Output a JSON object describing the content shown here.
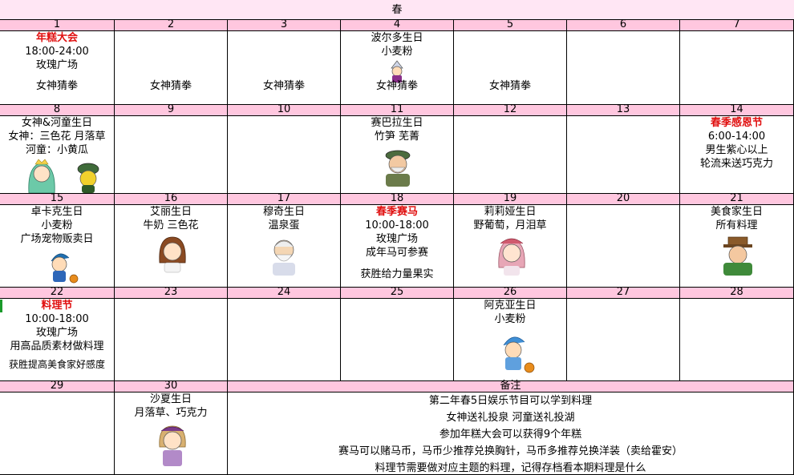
{
  "season": "春",
  "days": {
    "1": {
      "num": "1",
      "title": "年糕大会",
      "lines": [
        "18:00-24:00",
        "玫瑰广场"
      ],
      "game": "女神猜拳"
    },
    "2": {
      "num": "2",
      "game": "女神猜拳"
    },
    "3": {
      "num": "3",
      "game": "女神猜拳"
    },
    "4": {
      "num": "4",
      "lines": [
        "波尔多生日",
        "小麦粉"
      ],
      "game": "女神猜拳"
    },
    "5": {
      "num": "5",
      "game": "女神猜拳"
    },
    "6": {
      "num": "6"
    },
    "7": {
      "num": "7"
    },
    "8": {
      "num": "8",
      "lines": [
        "女神&河童生日",
        "女神：三色花 月落草",
        "河童：小黄瓜"
      ]
    },
    "9": {
      "num": "9"
    },
    "10": {
      "num": "10"
    },
    "11": {
      "num": "11",
      "lines": [
        "赛巴拉生日",
        "竹笋 芜菁"
      ]
    },
    "12": {
      "num": "12"
    },
    "13": {
      "num": "13"
    },
    "14": {
      "num": "14",
      "title": "春季感恩节",
      "lines": [
        "6:00-14:00",
        "男生紫心以上",
        "轮流来送巧克力"
      ]
    },
    "15": {
      "num": "15",
      "lines": [
        "卓卡克生日",
        "小麦粉",
        "广场宠物贩卖日"
      ]
    },
    "16": {
      "num": "16",
      "lines": [
        "艾丽生日",
        "牛奶 三色花"
      ]
    },
    "17": {
      "num": "17",
      "lines": [
        "穆奇生日",
        "温泉蛋"
      ]
    },
    "18": {
      "num": "18",
      "title": "春季赛马",
      "lines": [
        "10:00-18:00",
        "玫瑰广场",
        "成年马可参赛"
      ],
      "extra": "获胜给力量果实"
    },
    "19": {
      "num": "19",
      "lines": [
        "莉莉娅生日",
        "野葡萄，月泪草"
      ]
    },
    "20": {
      "num": "20"
    },
    "21": {
      "num": "21",
      "lines": [
        "美食家生日",
        "所有料理"
      ]
    },
    "22": {
      "num": "22",
      "title": "料理节",
      "lines": [
        "10:00-18:00",
        "玫瑰广场",
        "用高品质素材做料理"
      ],
      "extra": "获胜提高美食家好感度"
    },
    "23": {
      "num": "23"
    },
    "24": {
      "num": "24"
    },
    "25": {
      "num": "25"
    },
    "26": {
      "num": "26",
      "lines": [
        "阿克亚生日",
        "小麦粉"
      ]
    },
    "27": {
      "num": "27"
    },
    "28": {
      "num": "28"
    },
    "29": {
      "num": "29"
    },
    "30": {
      "num": "30",
      "lines": [
        "沙夏生日",
        "月落草、巧克力"
      ]
    }
  },
  "notes": {
    "header": "备注",
    "lines": [
      "第二年春5日娱乐节目可以学到料理",
      "女神送礼投泉 河童送礼投湖",
      "参加年糕大会可以获得9个年糕",
      "赛马可以赌马币，马币少推荐兑换胸针，马币多推荐兑换洋装（卖给霍安）",
      "料理节需要做对应主题的料理，记得存档看本期料理是什么"
    ]
  },
  "colors": {
    "header_pink": "#ffc7df",
    "season_bg": "#ffe6f4",
    "festival_red": "#e01010"
  },
  "avatars": [
    "bordeaux-avatar",
    "goddess-avatar",
    "kappa-avatar",
    "sebara-avatar",
    "joker-avatar",
    "ellie-avatar",
    "mukki-avatar",
    "lillia-avatar",
    "gourmet-avatar",
    "akya-avatar",
    "sasha-avatar"
  ]
}
